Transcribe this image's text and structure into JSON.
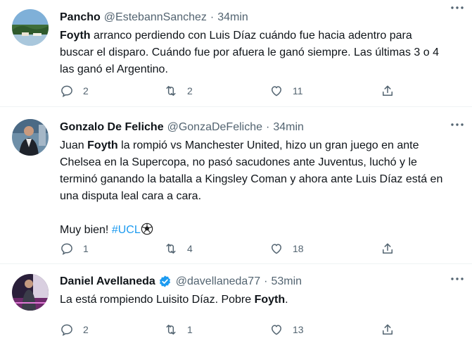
{
  "tweets": [
    {
      "name": "Pancho",
      "handle": "@EstebannSanchez",
      "dot": "·",
      "time": "34min",
      "verified": false,
      "lines": [
        [
          {
            "t": "Foyth",
            "b": true
          },
          {
            "t": " arranco perdiendo con Luis Díaz cuándo fue hacia adentro para"
          }
        ],
        [
          {
            "t": "buscar el disparo. Cuándo fue por afuera le ganó siempre. Las últimas 3 o 4"
          }
        ],
        [
          {
            "t": "las ganó el Argentino."
          }
        ]
      ],
      "replies": "2",
      "retweets": "2",
      "likes": "11"
    },
    {
      "name": "Gonzalo De Feliche",
      "handle": "@GonzaDeFeliche",
      "dot": "·",
      "time": "34min",
      "verified": false,
      "lines": [
        [
          {
            "t": "Juan "
          },
          {
            "t": "Foyth",
            "b": true
          },
          {
            "t": " la rompió vs Manchester United, hizo un gran juego en ante"
          }
        ],
        [
          {
            "t": "Chelsea en la Supercopa, no pasó sacudones ante Juventus, luchó y le"
          }
        ],
        [
          {
            "t": "terminó ganando la batalla a Kingsley Coman y ahora ante Luis Díaz está en"
          }
        ],
        [
          {
            "t": "una disputa leal cara a cara."
          }
        ],
        [
          {
            "t": " "
          }
        ],
        [
          {
            "t": "Muy bien! "
          },
          {
            "t": "#UCL",
            "h": true
          },
          {
            "e": "soccer-ball-icon"
          }
        ]
      ],
      "replies": "1",
      "retweets": "4",
      "likes": "18"
    },
    {
      "name": "Daniel Avellaneda",
      "handle": "@davellaneda77",
      "dot": "·",
      "time": "53min",
      "verified": true,
      "lines": [
        [
          {
            "t": "La está rompiendo Luisito Díaz. Pobre "
          },
          {
            "t": "Foyth",
            "b": true
          },
          {
            "t": "."
          }
        ]
      ],
      "replies": "2",
      "retweets": "1",
      "likes": "13"
    }
  ],
  "colors": {
    "text": "#0f1419",
    "secondary": "#536471",
    "link": "#1d9bf0",
    "verified": "#1d9bf0",
    "divider": "#eff3f4"
  }
}
